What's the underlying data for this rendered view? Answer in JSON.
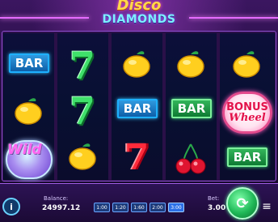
{
  "logo": {
    "line1": "Disco",
    "line2": "DIAMONDS"
  },
  "reels": {
    "r1": {
      "top": "BAR",
      "middle": "lemon",
      "bottom": "Wild"
    },
    "r2": {
      "top": "7",
      "middle": "7",
      "bottom": "lemon"
    },
    "r3": {
      "top": "lemon",
      "middle": "BAR",
      "bottom": "7"
    },
    "r4": {
      "top": "lemon",
      "middle": "BAR",
      "bottom": "cherries"
    },
    "r5": {
      "top": "lemon",
      "bonus_line1": "BONUS",
      "bonus_line2": "Wheel",
      "bottom": "BAR"
    }
  },
  "hud": {
    "balance_label": "Balance:",
    "balance_value": "24997.12",
    "bet_label": "Bet:",
    "bet_value": "3.00",
    "info_label": "i",
    "menu_label": "≡",
    "spin_label": "⟳",
    "bet_chips": [
      "1:00",
      "1:20",
      "1:60",
      "2:00",
      "3:00"
    ],
    "active_chip": "3:00"
  },
  "colors": {
    "accent": "#e56bff",
    "bar_blue": "#0e5fa8",
    "bar_green": "#0e7a33",
    "spin_green": "#1fb857"
  }
}
